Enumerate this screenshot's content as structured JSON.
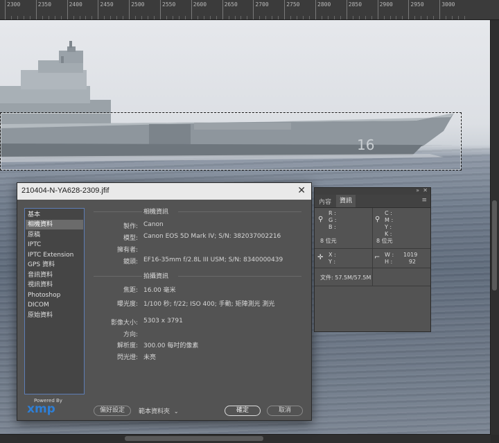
{
  "ruler": {
    "labels": [
      "2300",
      "2350",
      "2400",
      "2450",
      "2500",
      "2550",
      "2600",
      "2650",
      "2700",
      "2750",
      "2800",
      "2850",
      "2900",
      "2950",
      "3000"
    ]
  },
  "dialog": {
    "title": "210404-N-YA628-2309.jfif",
    "categories": [
      "基本",
      "相機資料",
      "原稿",
      "IPTC",
      "IPTC Extension",
      "GPS 資料",
      "音訊資料",
      "視訊資料",
      "Photoshop",
      "DICOM",
      "原始資料"
    ],
    "camera_section": "相機資訊",
    "camera_fields": [
      {
        "label": "製作:",
        "value": "Canon"
      },
      {
        "label": "模型:",
        "value": "Canon EOS 5D Mark IV;   S/N: 382037002216"
      },
      {
        "label": "擁有者:",
        "value": ""
      },
      {
        "label": "鏡頭:",
        "value": "EF16-35mm f/2.8L III USM;   S/N: 8340000439"
      }
    ],
    "shoot_section": "拍攝資訊",
    "shoot_fields": [
      {
        "label": "焦距:",
        "value": "16.00 毫米"
      },
      {
        "label": "曝光度:",
        "value": "1/100 秒;   f/22;   ISO 400;   手動;   矩陣測光 測光"
      }
    ],
    "image_fields": [
      {
        "label": "影像大小:",
        "value": "5303 x 3791"
      },
      {
        "label": "方向:",
        "value": ""
      },
      {
        "label": "解析度:",
        "value": "300.00 每吋的像素"
      },
      {
        "label": "閃光燈:",
        "value": "未亮"
      }
    ],
    "powered_by": "Powered By",
    "xmp_logo": "xmp",
    "preferences_button": "偏好設定",
    "template_folder": "範本資料夾",
    "ok_button": "確定",
    "cancel_button": "取消"
  },
  "info_panel": {
    "tabs": [
      "內容",
      "資訊"
    ],
    "rgb_labels": [
      "R :",
      "G :",
      "B :"
    ],
    "cmyk_labels": [
      "C :",
      "M :",
      "Y :",
      "K :"
    ],
    "bit_left": "8 位元",
    "bit_right": "8 位元",
    "x_label": "X :",
    "y_label": "Y :",
    "w_label": "W :",
    "h_label": "H :",
    "w_value": "1019",
    "h_value": "92",
    "doc_size": "文件: 57.5M/57.5M"
  },
  "icons": {
    "eyedropper": "eyedropper-icon",
    "crosshair": "crosshair-icon",
    "selection_box": "selection-size-icon",
    "close": "close-icon",
    "dropdown": "chevron-down-icon",
    "menu": "panel-menu-icon"
  },
  "colors": {
    "accent": "#2e7fd6",
    "dialog_bg": "#535353",
    "list_border": "#5e7eb6"
  }
}
